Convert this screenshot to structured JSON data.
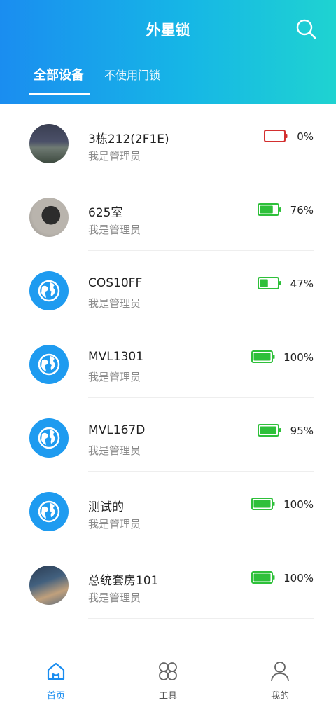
{
  "header": {
    "title": "外星锁",
    "tabs": [
      {
        "label": "全部设备"
      },
      {
        "label": "不使用门锁"
      }
    ]
  },
  "devices": [
    {
      "name": "3栋212(2F1E)",
      "role": "我是管理员",
      "battery_pct": "0%",
      "battery_level": 0.0,
      "battery_color": "#d32f2f",
      "avatar": "photo"
    },
    {
      "name": "625室",
      "role": "我是管理员",
      "battery_pct": "76%",
      "battery_level": 0.76,
      "battery_color": "#2ec03a",
      "avatar": "photo"
    },
    {
      "name": "COS10FF",
      "role": "我是管理员",
      "battery_pct": "47%",
      "battery_level": 0.47,
      "battery_color": "#2ec03a",
      "avatar": "globe-icon"
    },
    {
      "name": "MVL1301",
      "role": "我是管理员",
      "battery_pct": "100%",
      "battery_level": 1.0,
      "battery_color": "#2ec03a",
      "avatar": "globe-icon"
    },
    {
      "name": "MVL167D",
      "role": "我是管理员",
      "battery_pct": "95%",
      "battery_level": 0.95,
      "battery_color": "#2ec03a",
      "avatar": "globe-icon"
    },
    {
      "name": "测试的",
      "role": "我是管理员",
      "battery_pct": "100%",
      "battery_level": 1.0,
      "battery_color": "#2ec03a",
      "avatar": "globe-icon"
    },
    {
      "name": "总统套房101",
      "role": "我是管理员",
      "battery_pct": "100%",
      "battery_level": 1.0,
      "battery_color": "#2ec03a",
      "avatar": "photo"
    }
  ],
  "nav": {
    "home": "首页",
    "tools": "工具",
    "mine": "我的"
  },
  "colors": {
    "accent": "#1a8df0",
    "battery_ok": "#2ec03a",
    "battery_empty": "#d32f2f"
  }
}
